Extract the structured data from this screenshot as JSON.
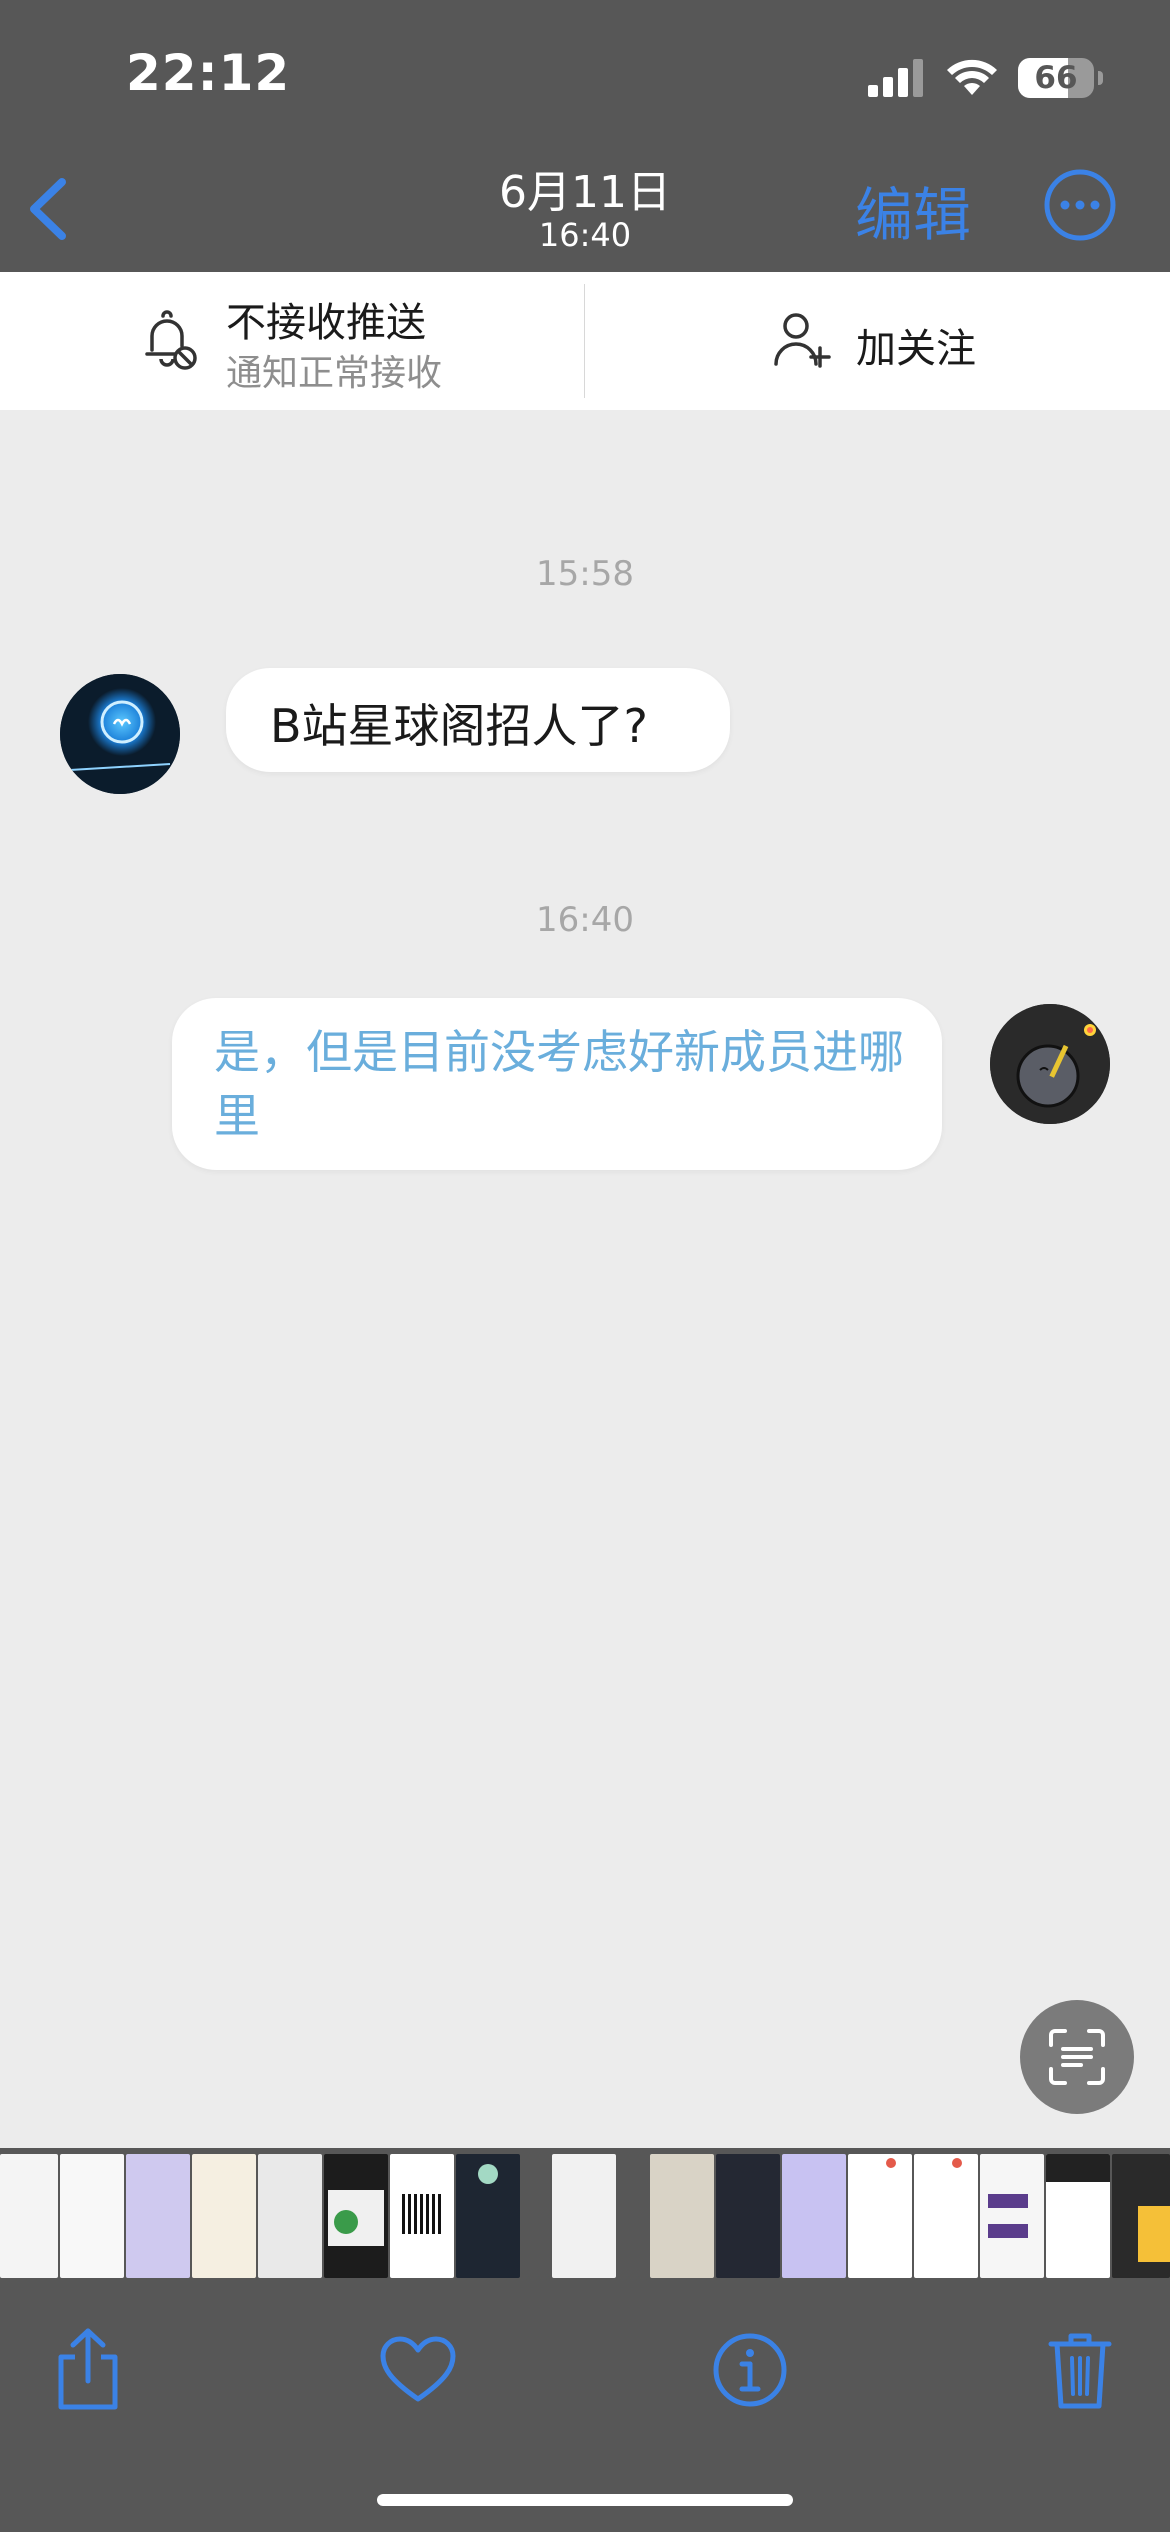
{
  "status_bar": {
    "time": "22:12",
    "battery_level": "66"
  },
  "nav": {
    "title": "6月11日",
    "subtitle": "16:40",
    "edit_label": "编辑"
  },
  "prefs": {
    "push_title": "不接收推送",
    "push_subtitle": "通知正常接收",
    "follow_label": "加关注"
  },
  "conversation": {
    "messages": [
      {
        "time": "15:58",
        "direction": "incoming",
        "text": "B站星球阁招人了?"
      },
      {
        "time": "16:40",
        "direction": "outgoing",
        "text": "是，但是目前没考虑好新成员进哪里"
      }
    ]
  },
  "colors": {
    "accent": "#3b82e6",
    "outgoing_text": "#6aaedc",
    "bar_bg": "#575757",
    "page_bg": "#ececec"
  },
  "icons": {
    "back": "chevron-left-icon",
    "more": "ellipsis-circle-icon",
    "bell": "bell-off-icon",
    "follow": "person-add-icon",
    "scan": "text-scan-icon",
    "share": "share-icon",
    "favorite": "heart-icon",
    "info": "info-icon",
    "delete": "trash-icon"
  }
}
